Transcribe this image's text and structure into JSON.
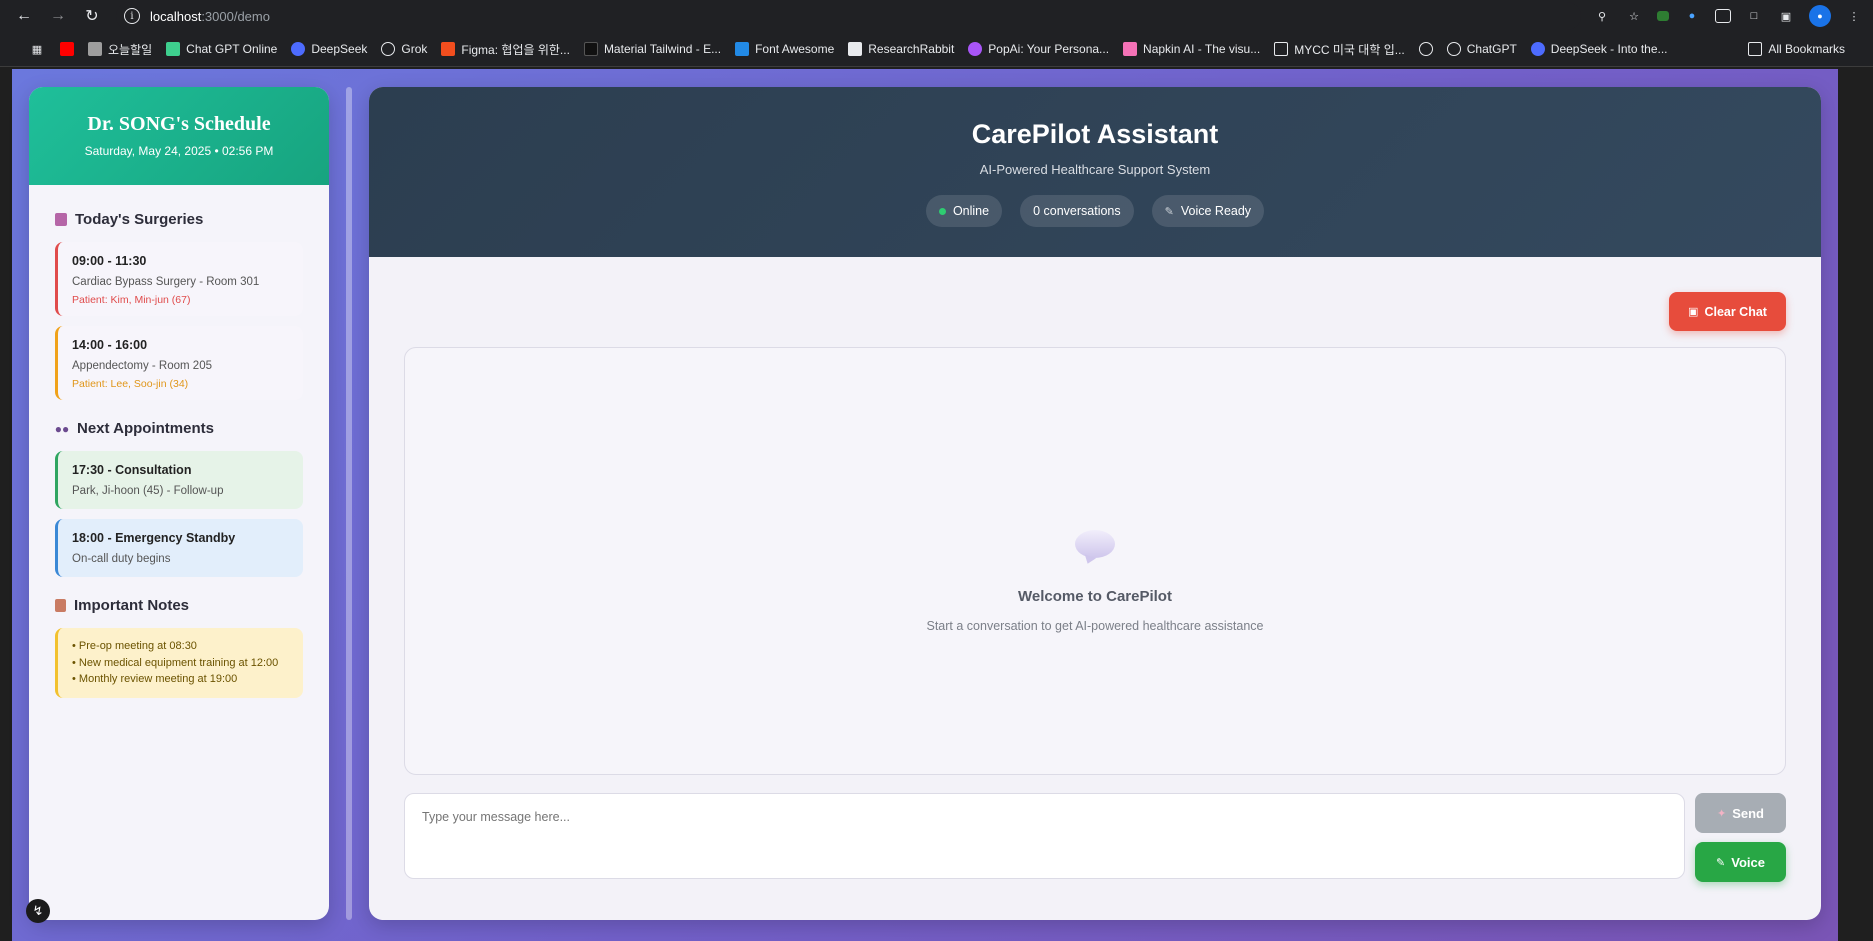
{
  "browser": {
    "url_host": "localhost",
    "url_path": ":3000/demo",
    "bookmarks": [
      {
        "label": "",
        "color": "#ff0000"
      },
      {
        "label": "오늘할일",
        "color": "#9e9e9e"
      },
      {
        "label": "Chat GPT Online",
        "color": "#3ecf8e"
      },
      {
        "label": "DeepSeek",
        "color": "#4d6bfe"
      },
      {
        "label": "Grok",
        "color": "#e8eaed"
      },
      {
        "label": "Figma: 협업을 위한...",
        "color": "#f24e1e"
      },
      {
        "label": "Material Tailwind - E...",
        "color": "#111111"
      },
      {
        "label": "Font Awesome",
        "color": "#228ae6"
      },
      {
        "label": "ResearchRabbit",
        "color": "#e8eaed"
      },
      {
        "label": "PopAi: Your Persona...",
        "color": "#a855f7"
      },
      {
        "label": "Napkin AI - The visu...",
        "color": "#f472b6"
      },
      {
        "label": "MYCC 미국 대학 입...",
        "color": "#e8eaed"
      },
      {
        "label": "",
        "color": "#e8eaed"
      },
      {
        "label": "ChatGPT",
        "color": "#e8eaed"
      },
      {
        "label": "DeepSeek - Into the...",
        "color": "#4d6bfe"
      }
    ],
    "all_bookmarks": "All Bookmarks"
  },
  "sidebar": {
    "title": "Dr. SONG's Schedule",
    "datetime": "Saturday, May 24, 2025 • 02:56 PM",
    "surgeries_title": "Today's Surgeries",
    "surgeries": [
      {
        "time": "09:00 - 11:30",
        "desc": "Cardiac Bypass Surgery - Room 301",
        "patient": "Patient: Kim, Min-jun (67)"
      },
      {
        "time": "14:00 - 16:00",
        "desc": "Appendectomy - Room 205",
        "patient": "Patient: Lee, Soo-jin (34)"
      }
    ],
    "appointments_title": "Next Appointments",
    "appointments": [
      {
        "title": "17:30 - Consultation",
        "desc": "Park, Ji-hoon (45) - Follow-up"
      },
      {
        "title": "18:00 - Emergency Standby",
        "desc": "On-call duty begins"
      }
    ],
    "notes_title": "Important Notes",
    "notes": [
      "• Pre-op meeting at 08:30",
      "• New medical equipment training at 12:00",
      "• Monthly review meeting at 19:00"
    ]
  },
  "main": {
    "title": "CarePilot Assistant",
    "subtitle": "AI-Powered Healthcare Support System",
    "status_online": "Online",
    "conversations": "0 conversations",
    "voice_ready": "Voice Ready",
    "clear_chat": "Clear Chat",
    "welcome_title": "Welcome to CarePilot",
    "welcome_sub": "Start a conversation to get AI-powered healthcare assistance",
    "input_placeholder": "Type your message here...",
    "send_label": "Send",
    "voice_label": "Voice"
  },
  "colors": {
    "accent_teal": "#1fbf9a",
    "header_dark": "#2c3e50",
    "danger": "#e74c3c",
    "success": "#28a745"
  }
}
